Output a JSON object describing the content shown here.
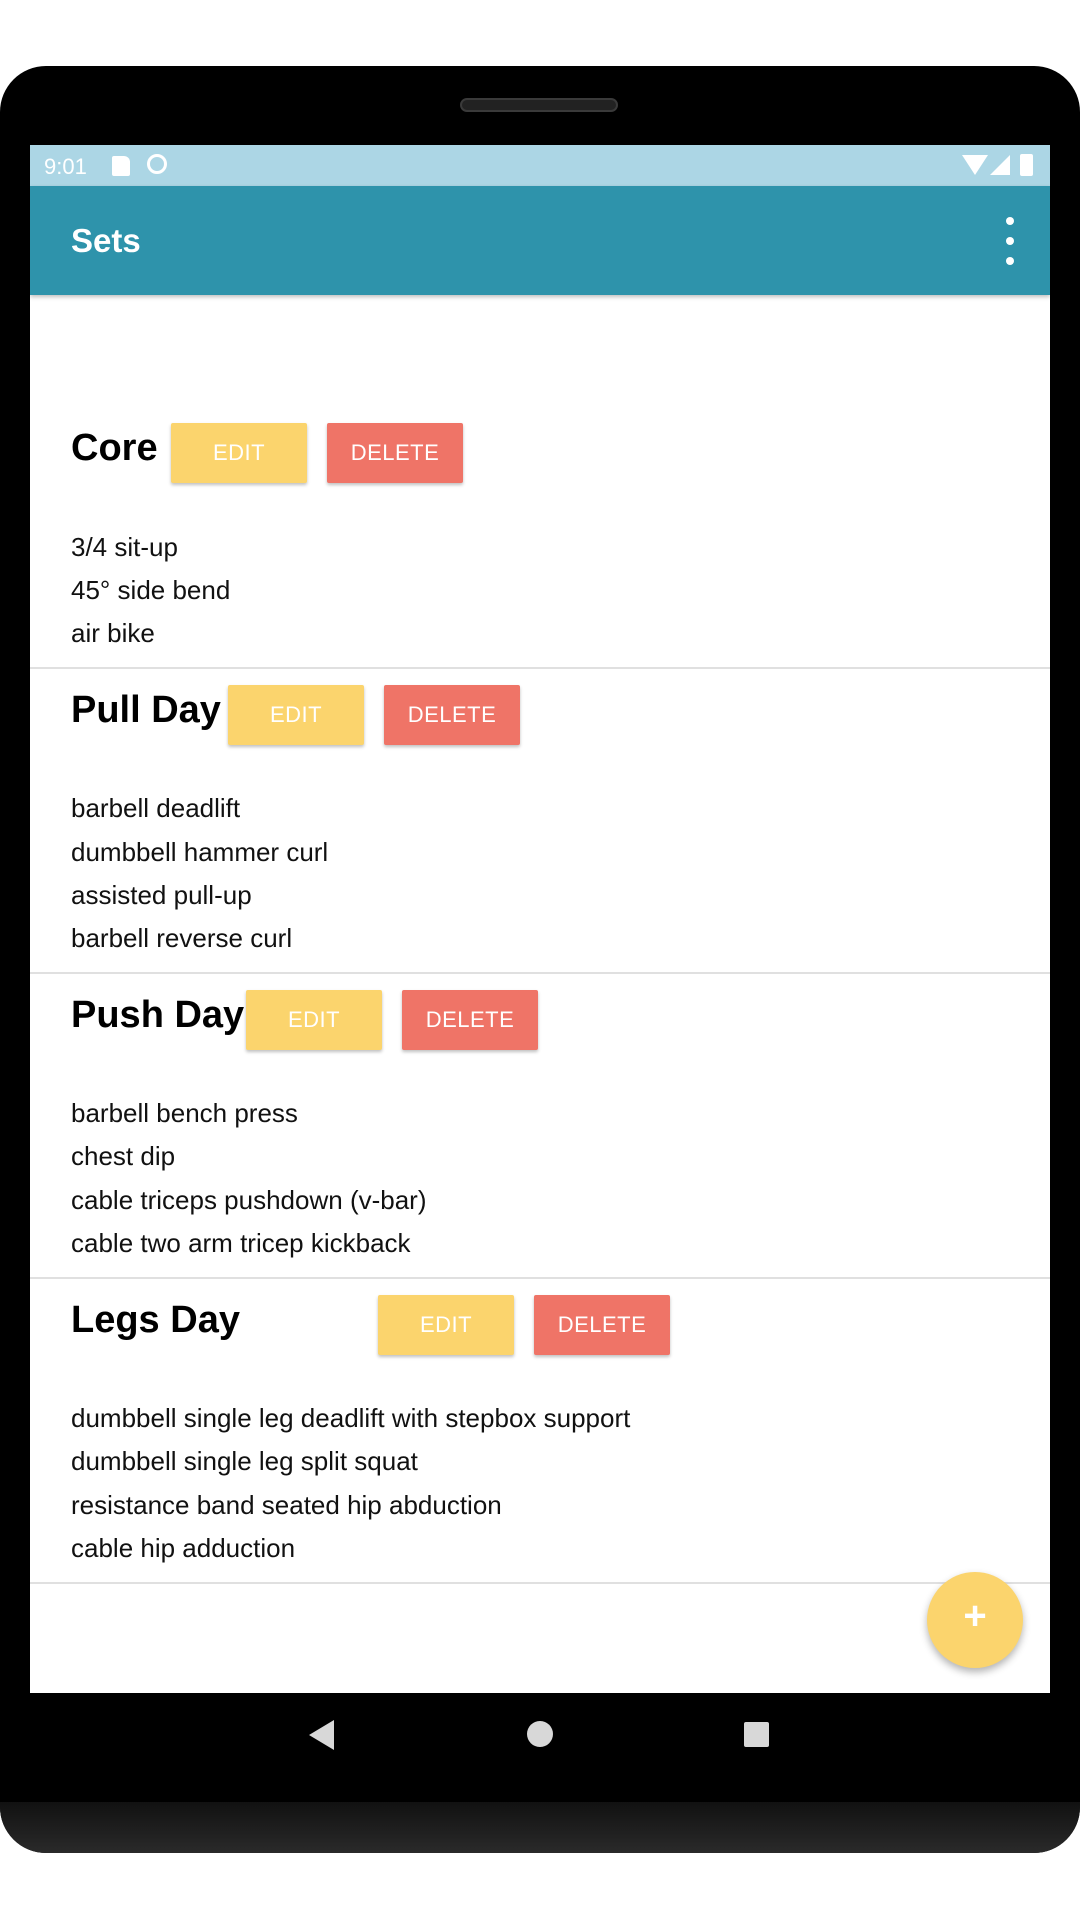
{
  "status_bar": {
    "time": "9:01",
    "icons": [
      "sd-card-icon",
      "sync-icon",
      "wifi-icon",
      "signal-icon",
      "battery-icon"
    ]
  },
  "app_bar": {
    "title": "Sets",
    "menu_icon": "more-vert-icon"
  },
  "colors": {
    "app_bar": "#2e93ab",
    "status_bar": "#acd6e5",
    "edit_button": "#fbd46d",
    "delete_button": "#ef7467",
    "fab": "#fbd46d"
  },
  "sets": [
    {
      "name": "Core",
      "edit_label": "EDIT",
      "delete_label": "DELETE",
      "exercises": [
        "3/4 sit-up",
        "45° side bend",
        "air bike"
      ]
    },
    {
      "name": "Pull Day",
      "edit_label": "EDIT",
      "delete_label": "DELETE",
      "exercises": [
        "barbell deadlift",
        "dumbbell hammer curl",
        "assisted pull-up",
        "barbell reverse curl"
      ]
    },
    {
      "name": "Push Day",
      "edit_label": "EDIT",
      "delete_label": "DELETE",
      "exercises": [
        "barbell bench press",
        "chest dip",
        "cable triceps pushdown (v-bar)",
        "cable two arm tricep kickback"
      ]
    },
    {
      "name": "Legs Day",
      "edit_label": "EDIT",
      "delete_label": "DELETE",
      "exercises": [
        "dumbbell single leg deadlift with stepbox support",
        "dumbbell single leg split squat",
        "resistance band seated hip abduction",
        "cable hip adduction"
      ]
    }
  ],
  "fab": {
    "label": "+",
    "icon": "add-icon"
  },
  "nav_bar": {
    "icons": [
      "back-icon",
      "home-icon",
      "recents-icon"
    ]
  }
}
